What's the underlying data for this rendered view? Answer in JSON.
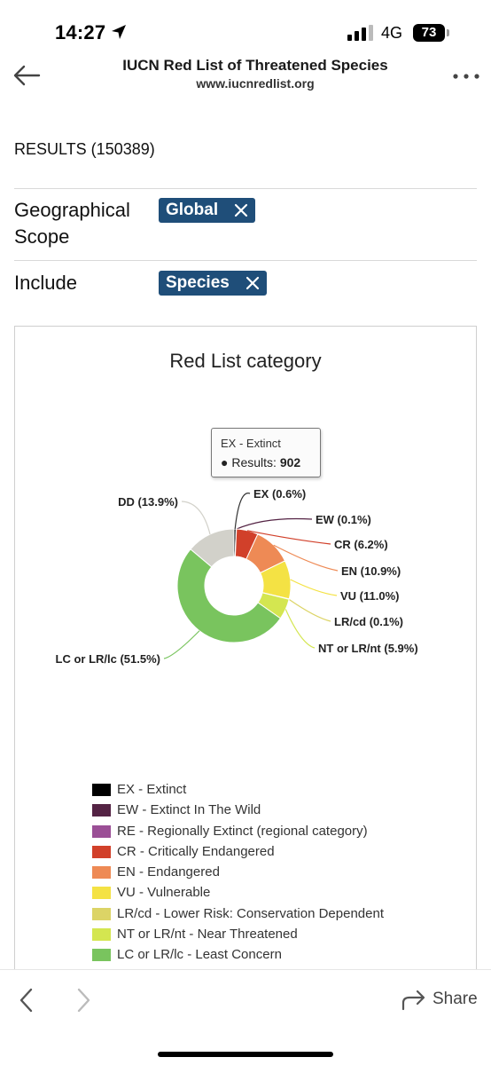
{
  "status_bar": {
    "time": "14:27",
    "network": "4G",
    "battery": "73"
  },
  "header": {
    "title": "IUCN Red List of Threatened Species",
    "url": "www.iucnredlist.org"
  },
  "results_label": "RESULTS (150389)",
  "filters": [
    {
      "label": "Geographical",
      "label2": "Scope",
      "chip": "Global"
    },
    {
      "label": "Include",
      "chip": "Species"
    }
  ],
  "tooltip": {
    "category": "EX - Extinct",
    "results_label": "Results:",
    "results_value": "902"
  },
  "chart_data": {
    "type": "pie",
    "title": "Red List category",
    "donut": true,
    "slices": [
      {
        "label": "EX (0.6%)",
        "value": 0.6,
        "color": "#000000"
      },
      {
        "label": "EW (0.1%)",
        "value": 0.1,
        "color": "#542344"
      },
      {
        "label": "CR (6.2%)",
        "value": 6.2,
        "color": "#d1402a"
      },
      {
        "label": "EN (10.9%)",
        "value": 10.9,
        "color": "#ee8a55"
      },
      {
        "label": "VU (11.0%)",
        "value": 11.0,
        "color": "#f4e244"
      },
      {
        "label": "LR/cd (0.1%)",
        "value": 0.1,
        "color": "#dcd466"
      },
      {
        "label": "NT or LR/nt (5.9%)",
        "value": 5.9,
        "color": "#d4e650"
      },
      {
        "label": "LC or LR/lc (51.5%)",
        "value": 51.5,
        "color": "#79c45e"
      },
      {
        "label": "DD (13.9%)",
        "value": 13.9,
        "color": "#d2d1ca"
      }
    ],
    "legend": [
      {
        "label": "EX - Extinct",
        "color": "#000000"
      },
      {
        "label": "EW - Extinct In The Wild",
        "color": "#542344"
      },
      {
        "label": "RE - Regionally Extinct (regional category)",
        "color": "#9b4f96"
      },
      {
        "label": "CR - Critically Endangered",
        "color": "#d1402a"
      },
      {
        "label": "EN - Endangered",
        "color": "#ee8a55"
      },
      {
        "label": "VU - Vulnerable",
        "color": "#f4e244"
      },
      {
        "label": "LR/cd - Lower Risk: Conservation Dependent",
        "color": "#dcd466"
      },
      {
        "label": "NT or LR/nt - Near Threatened",
        "color": "#d4e650"
      },
      {
        "label": "LC or LR/lc - Least Concern",
        "color": "#79c45e"
      }
    ]
  },
  "bottom_bar": {
    "share_label": "Share"
  }
}
